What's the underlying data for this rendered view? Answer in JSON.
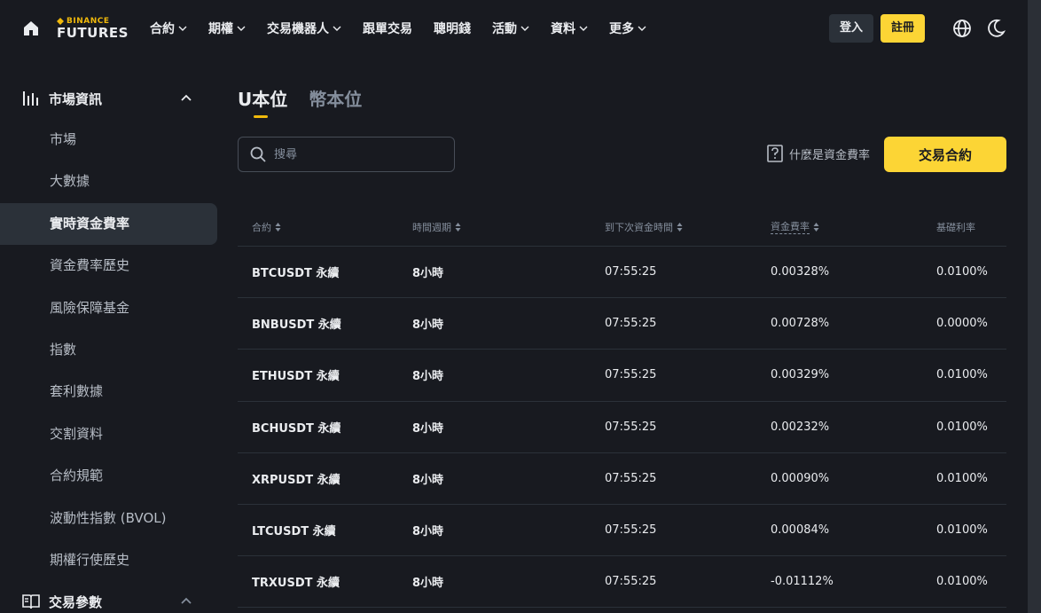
{
  "brand": {
    "line1": "BINANCE",
    "line2": "FUTURES"
  },
  "nav": {
    "items": [
      {
        "label": "合約",
        "dropdown": true
      },
      {
        "label": "期權",
        "dropdown": true
      },
      {
        "label": "交易機器人",
        "dropdown": true
      },
      {
        "label": "跟單交易",
        "dropdown": false
      },
      {
        "label": "聰明錢",
        "dropdown": false
      },
      {
        "label": "活動",
        "dropdown": true
      },
      {
        "label": "資料",
        "dropdown": true
      },
      {
        "label": "更多",
        "dropdown": true
      }
    ],
    "login": "登入",
    "register": "註冊"
  },
  "sidebar": {
    "group1": "市場資訊",
    "items": [
      "市場",
      "大數據",
      "實時資金費率",
      "資金費率歷史",
      "風險保障基金",
      "指數",
      "套利數據",
      "交割資料",
      "合約規範",
      "波動性指數 (BVOL)",
      "期權行使歷史"
    ],
    "active_index": 2,
    "group2": "交易參數"
  },
  "main": {
    "tabs": [
      "U本位",
      "幣本位"
    ],
    "active_tab": 0,
    "search_placeholder": "搜尋",
    "help_text": "什麼是資金費率",
    "trade_button": "交易合約"
  },
  "table": {
    "headers": [
      "合約",
      "時間週期",
      "到下次資金時間",
      "資金費率",
      "基礎利率"
    ],
    "rows": [
      [
        "BTCUSDT 永續",
        "8小時",
        "07:55:25",
        "0.00328%",
        "0.0100%"
      ],
      [
        "BNBUSDT 永續",
        "8小時",
        "07:55:25",
        "0.00728%",
        "0.0000%"
      ],
      [
        "ETHUSDT 永續",
        "8小時",
        "07:55:25",
        "0.00329%",
        "0.0100%"
      ],
      [
        "BCHUSDT 永續",
        "8小時",
        "07:55:25",
        "0.00232%",
        "0.0100%"
      ],
      [
        "XRPUSDT 永續",
        "8小時",
        "07:55:25",
        "0.00090%",
        "0.0100%"
      ],
      [
        "LTCUSDT 永續",
        "8小時",
        "07:55:25",
        "0.00084%",
        "0.0100%"
      ],
      [
        "TRXUSDT 永續",
        "8小時",
        "07:55:25",
        "-0.01112%",
        "0.0100%"
      ]
    ]
  },
  "colors": {
    "accent": "#fcd535",
    "background": "#181a20",
    "active_bg": "#2b3139"
  }
}
